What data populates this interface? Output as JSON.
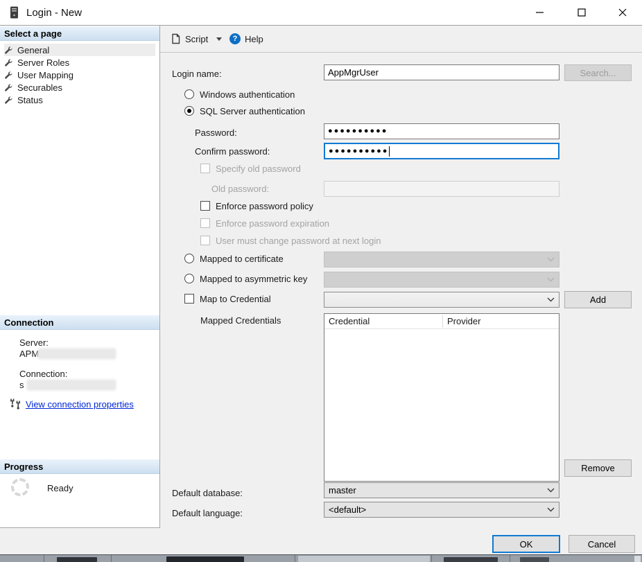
{
  "window": {
    "title": "Login - New"
  },
  "toolbar": {
    "script_label": "Script",
    "help_label": "Help"
  },
  "sidebar": {
    "select_page_header": "Select a page",
    "pages": [
      {
        "label": "General"
      },
      {
        "label": "Server Roles"
      },
      {
        "label": "User Mapping"
      },
      {
        "label": "Securables"
      },
      {
        "label": "Status"
      }
    ],
    "connection_header": "Connection",
    "server_label": "Server:",
    "server_value": "APM",
    "connection_label": "Connection:",
    "connection_value": "s",
    "view_connection_properties": "View connection properties",
    "progress_header": "Progress",
    "progress_status": "Ready"
  },
  "form": {
    "login_name_label": "Login name:",
    "login_name_value": "AppMgrUser",
    "search_button": "Search...",
    "windows_auth_label": "Windows authentication",
    "sql_auth_label": "SQL Server authentication",
    "password_label": "Password:",
    "password_value": "●●●●●●●●●●",
    "confirm_password_label": "Confirm password:",
    "confirm_password_value": "●●●●●●●●●●",
    "specify_old_password_label": "Specify old password",
    "old_password_label": "Old password:",
    "enforce_policy_label": "Enforce password policy",
    "enforce_expiration_label": "Enforce password expiration",
    "must_change_label": "User must change password at next login",
    "mapped_certificate_label": "Mapped to certificate",
    "mapped_asymmetric_label": "Mapped to asymmetric key",
    "map_credential_label": "Map to Credential",
    "add_button": "Add",
    "mapped_credentials_label": "Mapped Credentials",
    "credentials_table": {
      "columns": [
        "Credential",
        "Provider"
      ],
      "rows": []
    },
    "remove_button": "Remove",
    "default_database_label": "Default database:",
    "default_database_value": "master",
    "default_language_label": "Default language:",
    "default_language_value": "<default>"
  },
  "footer": {
    "ok_button": "OK",
    "cancel_button": "Cancel"
  },
  "colors": {
    "accent_blue": "#0f7ad4",
    "link_blue": "#0026d8",
    "disabled_text": "#a3a3a3",
    "section_header_top": "#e9f2fb",
    "section_header_bottom": "#cddff0"
  }
}
